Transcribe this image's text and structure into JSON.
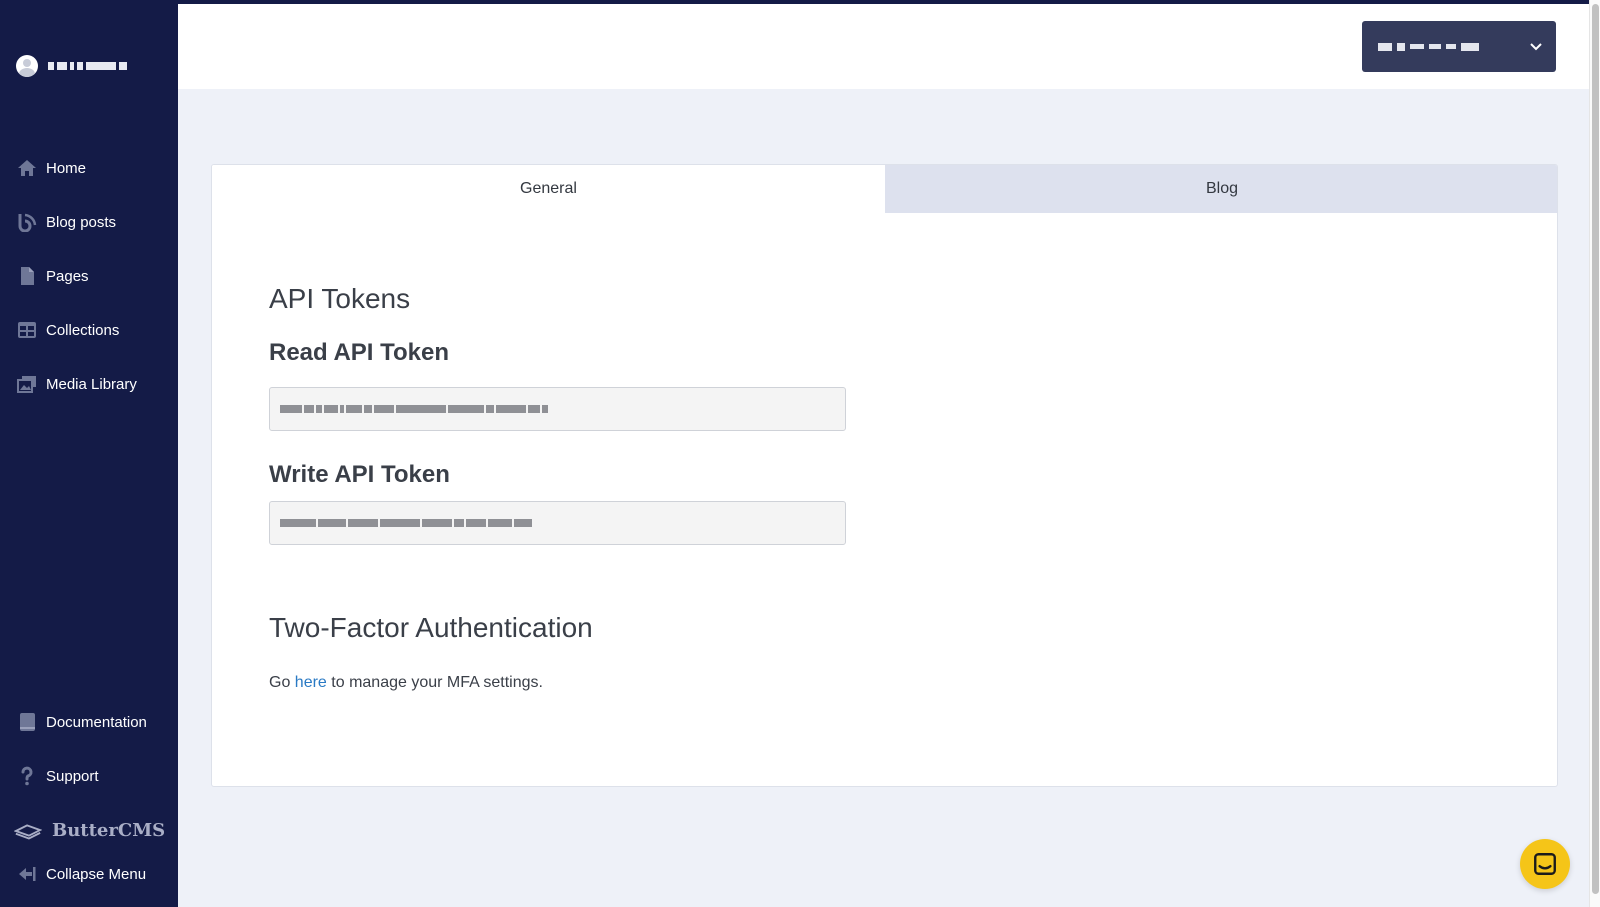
{
  "sidebar": {
    "nav_items": [
      {
        "label": "Home",
        "icon": "home-icon"
      },
      {
        "label": "Blog posts",
        "icon": "blog-posts-icon"
      },
      {
        "label": "Pages",
        "icon": "page-icon"
      },
      {
        "label": "Collections",
        "icon": "collections-icon"
      },
      {
        "label": "Media Library",
        "icon": "media-library-icon"
      }
    ],
    "bottom_items": [
      {
        "label": "Documentation",
        "icon": "book-icon"
      },
      {
        "label": "Support",
        "icon": "question-icon"
      }
    ],
    "brand_name": "ButterCMS",
    "collapse_label": "Collapse Menu"
  },
  "tabs": [
    {
      "label": "General",
      "active": true
    },
    {
      "label": "Blog",
      "active": false
    }
  ],
  "api_tokens": {
    "title": "API Tokens",
    "read_label": "Read API Token",
    "write_label": "Write API Token"
  },
  "two_factor": {
    "title": "Two-Factor Authentication",
    "text_before": "Go ",
    "link_text": "here",
    "text_after": " to manage your MFA settings."
  },
  "colors": {
    "sidebar_bg": "#141b47",
    "main_bg": "#eef1f8",
    "link": "#2a7ac4",
    "chat_bubble": "#f5c518",
    "org_select_bg": "#343b5c"
  }
}
